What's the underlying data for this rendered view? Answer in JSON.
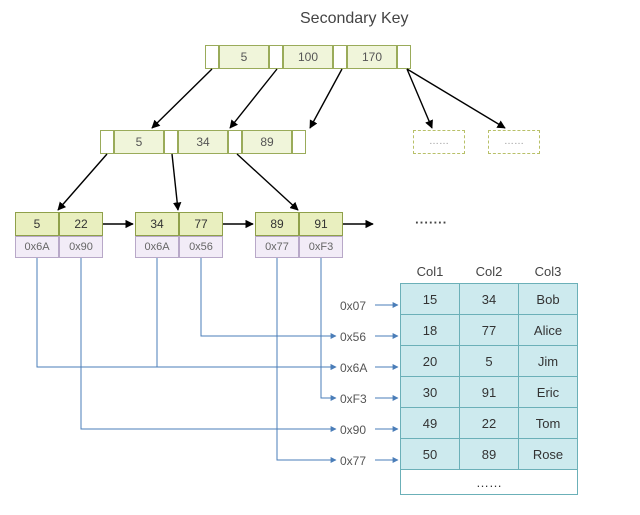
{
  "title": "Secondary Key",
  "root_node": [
    "5",
    "100",
    "170"
  ],
  "level2_node": [
    "5",
    "34",
    "89"
  ],
  "leaves": [
    {
      "keys": [
        "5",
        "22"
      ],
      "addrs": [
        "0x6A",
        "0x90"
      ]
    },
    {
      "keys": [
        "34",
        "77"
      ],
      "addrs": [
        "0x6A",
        "0x56"
      ]
    },
    {
      "keys": [
        "89",
        "91"
      ],
      "addrs": [
        "0x77",
        "0xF3"
      ]
    }
  ],
  "ghost_label": "……",
  "leaf_ellipsis": "∙∙∙∙∙∙∙",
  "addr_labels": [
    "0x07",
    "0x56",
    "0x6A",
    "0xF3",
    "0x90",
    "0x77"
  ],
  "table": {
    "headers": [
      "Col1",
      "Col2",
      "Col3"
    ],
    "rows": [
      [
        "15",
        "34",
        "Bob"
      ],
      [
        "18",
        "77",
        "Alice"
      ],
      [
        "20",
        "5",
        "Jim"
      ],
      [
        "30",
        "91",
        "Eric"
      ],
      [
        "49",
        "22",
        "Tom"
      ],
      [
        "50",
        "89",
        "Rose"
      ]
    ],
    "ellipsis": "……"
  },
  "chart_data": {
    "type": "table",
    "description": "B-tree secondary index over Col2 mapping key values to row pointers (hex addresses) into a data page table",
    "index": {
      "root": [
        5,
        100,
        170
      ],
      "internal": [
        [
          5,
          34,
          89
        ]
      ],
      "leaves": [
        {
          "key": 5,
          "ptr": "0x6A"
        },
        {
          "key": 22,
          "ptr": "0x90"
        },
        {
          "key": 34,
          "ptr": "0x6A"
        },
        {
          "key": 77,
          "ptr": "0x56"
        },
        {
          "key": 89,
          "ptr": "0x77"
        },
        {
          "key": 91,
          "ptr": "0xF3"
        }
      ]
    },
    "data_page": {
      "columns": [
        "Col1",
        "Col2",
        "Col3"
      ],
      "rows": [
        {
          "addr": "0x07",
          "Col1": 15,
          "Col2": 34,
          "Col3": "Bob"
        },
        {
          "addr": "0x56",
          "Col1": 18,
          "Col2": 77,
          "Col3": "Alice"
        },
        {
          "addr": "0x6A",
          "Col1": 20,
          "Col2": 5,
          "Col3": "Jim"
        },
        {
          "addr": "0xF3",
          "Col1": 30,
          "Col2": 91,
          "Col3": "Eric"
        },
        {
          "addr": "0x90",
          "Col1": 49,
          "Col2": 22,
          "Col3": "Tom"
        },
        {
          "addr": "0x77",
          "Col1": 50,
          "Col2": 89,
          "Col3": "Rose"
        }
      ]
    }
  }
}
